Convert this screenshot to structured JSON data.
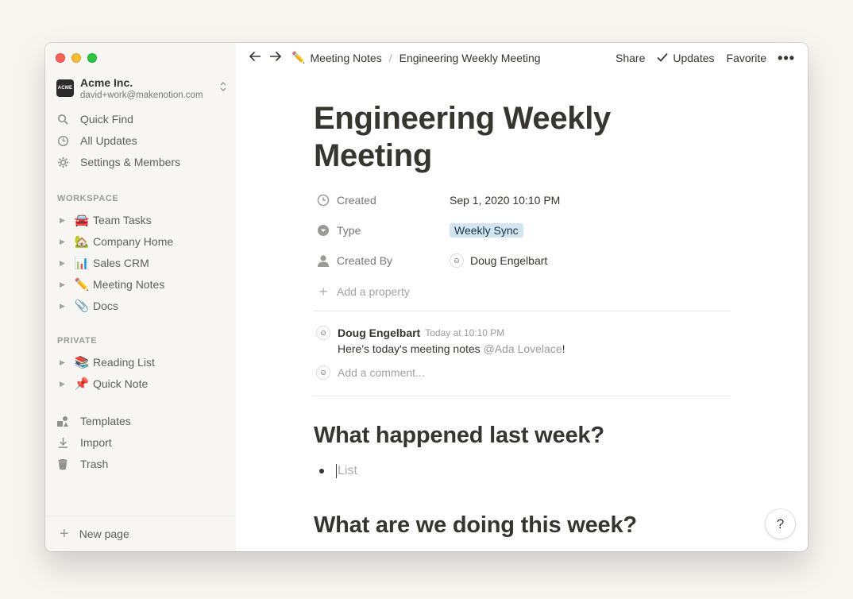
{
  "window": {
    "traffic_lights": [
      "close",
      "minimize",
      "zoom"
    ]
  },
  "workspace": {
    "logo_text": "ACME",
    "name": "Acme Inc.",
    "email": "david+work@makenotion.com",
    "switch_icon": "chevron-updown-icon"
  },
  "sidebar": {
    "nav": [
      {
        "label": "Quick Find",
        "icon": "search-icon"
      },
      {
        "label": "All Updates",
        "icon": "clock-icon"
      },
      {
        "label": "Settings & Members",
        "icon": "gear-icon"
      }
    ],
    "workspace_label": "WORKSPACE",
    "workspace_pages": [
      {
        "emoji": "🚘",
        "label": "Team Tasks"
      },
      {
        "emoji": "🏡",
        "label": "Company Home"
      },
      {
        "emoji": "📊",
        "label": "Sales CRM"
      },
      {
        "emoji": "✏️",
        "label": "Meeting Notes"
      },
      {
        "emoji": "📎",
        "label": "Docs"
      }
    ],
    "private_label": "PRIVATE",
    "private_pages": [
      {
        "emoji": "📚",
        "label": "Reading List"
      },
      {
        "emoji": "📌",
        "label": "Quick Note"
      }
    ],
    "footer_nav": [
      {
        "label": "Templates",
        "icon": "shapes-icon"
      },
      {
        "label": "Import",
        "icon": "download-icon"
      },
      {
        "label": "Trash",
        "icon": "trash-icon"
      }
    ],
    "new_page_label": "New page"
  },
  "topbar": {
    "breadcrumb": [
      {
        "emoji": "✏️",
        "label": "Meeting Notes"
      },
      {
        "label": "Engineering Weekly Meeting"
      }
    ],
    "separator": "/",
    "share_label": "Share",
    "updates_label": "Updates",
    "favorite_label": "Favorite"
  },
  "page": {
    "title_line1": "Engineering Weekly",
    "title_line2": "Meeting",
    "properties": [
      {
        "icon": "clock-icon",
        "name": "Created",
        "value": "Sep 1, 2020 10:10 PM"
      },
      {
        "icon": "select-icon",
        "name": "Type",
        "value": "Weekly Sync"
      },
      {
        "icon": "person-icon",
        "name": "Created By",
        "value": "Doug Engelbart"
      }
    ],
    "add_property_label": "Add a property",
    "comment": {
      "author": "Doug Engelbart",
      "time": "Today at 10:10 PM",
      "text_before": "Here's today's meeting notes ",
      "mention": "@Ada Lovelace",
      "text_after": "!"
    },
    "add_comment_placeholder": "Add a comment...",
    "heading1": "What happened last week?",
    "list_placeholder": "List",
    "heading2": "What are we doing this week?"
  },
  "help_label": "?",
  "colors": {
    "sidebar_bg": "#f7f6f3",
    "tag_bg": "#d3e5ef",
    "page_bg": "#f9f6f2"
  }
}
